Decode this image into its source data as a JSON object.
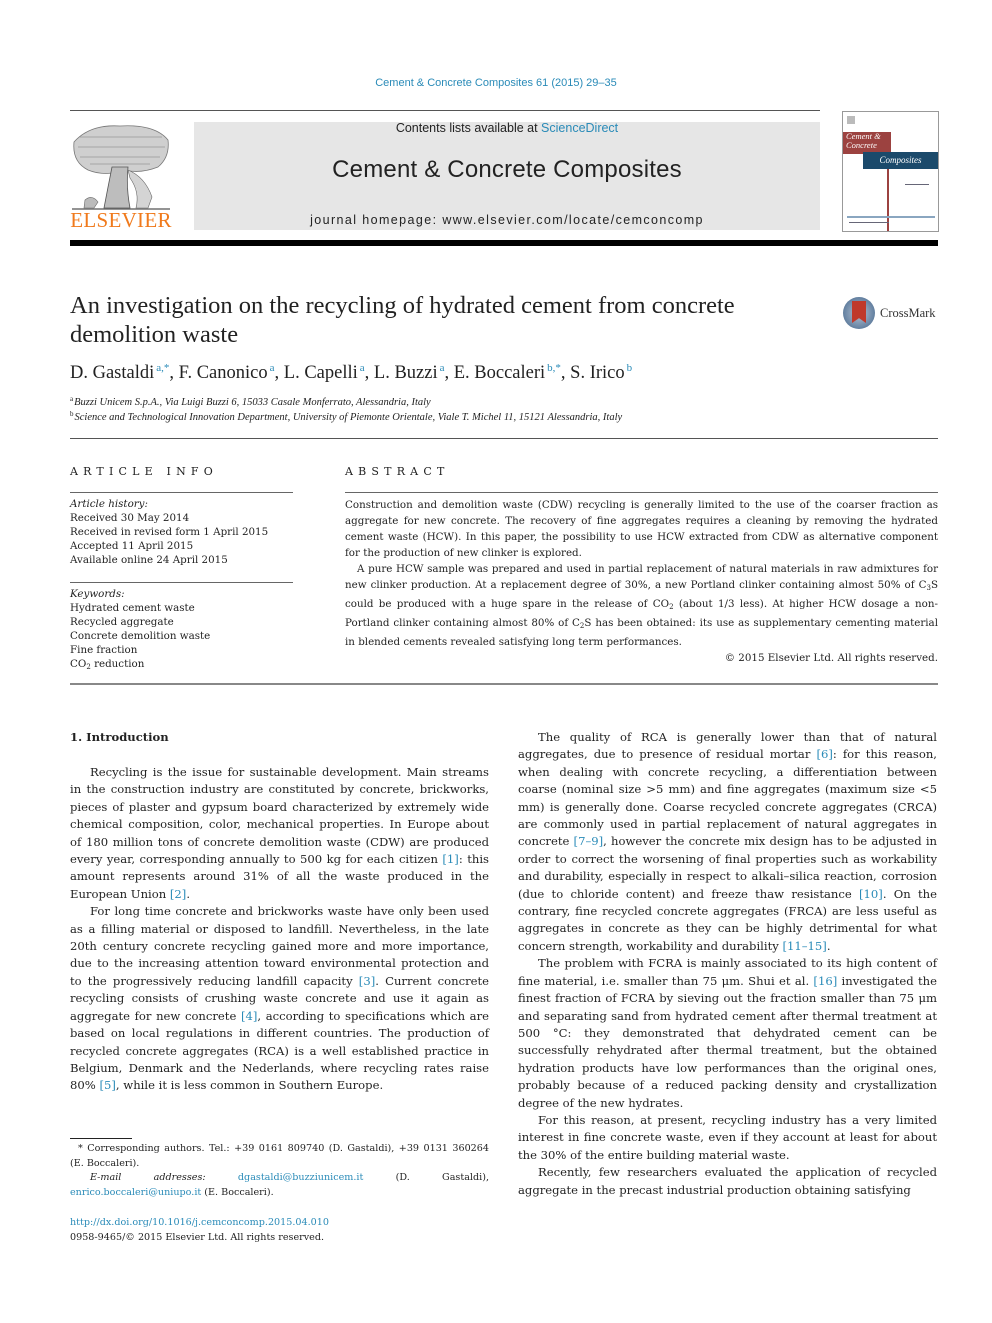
{
  "header": {
    "journal_ref": "Cement & Concrete Composites 61 (2015) 29–35",
    "contents_prefix": "Contents lists available at ",
    "contents_link": "ScienceDirect",
    "journal_name": "Cement & Concrete Composites",
    "homepage_prefix": "journal homepage: ",
    "homepage_url": "www.elsevier.com/locate/cemconcomp",
    "publisher_logo_text": "ELSEVIER",
    "cover": {
      "line1": "Cement &",
      "line2": "Concrete",
      "line3": "Composites"
    }
  },
  "article": {
    "title": "An investigation on the recycling of hydrated cement from concrete demolition waste",
    "crossmark_label": "CrossMark",
    "authors": [
      {
        "name": "D. Gastaldi",
        "sup": "a,*"
      },
      {
        "name": "F. Canonico",
        "sup": "a"
      },
      {
        "name": "L. Capelli",
        "sup": "a"
      },
      {
        "name": "L. Buzzi",
        "sup": "a"
      },
      {
        "name": "E. Boccaleri",
        "sup": "b,*"
      },
      {
        "name": "S. Irico",
        "sup": "b"
      }
    ],
    "affiliations": [
      {
        "key": "a",
        "text": "Buzzi Unicem S.p.A., Via Luigi Buzzi 6, 15033 Casale Monferrato, Alessandria, Italy"
      },
      {
        "key": "b",
        "text": "Science and Technological Innovation Department, University of Piemonte Orientale, Viale T. Michel 11, 15121 Alessandria, Italy"
      }
    ]
  },
  "article_info": {
    "heading": "ARTICLE INFO",
    "history_label": "Article history:",
    "history": [
      "Received 30 May 2014",
      "Received in revised form 1 April 2015",
      "Accepted 11 April 2015",
      "Available online 24 April 2015"
    ],
    "keywords_label": "Keywords:",
    "keywords": [
      "Hydrated cement waste",
      "Recycled aggregate",
      "Concrete demolition waste",
      "Fine fraction"
    ],
    "keyword_co2_prefix": "CO",
    "keyword_co2_sub": "2",
    "keyword_co2_suffix": " reduction"
  },
  "abstract": {
    "heading": "ABSTRACT",
    "p1": "Construction and demolition waste (CDW) recycling is generally limited to the use of the coarser fraction as aggregate for new concrete. The recovery of fine aggregates requires a cleaning by removing the hydrated cement waste (HCW). In this paper, the possibility to use HCW extracted from CDW as alternative component for the production of new clinker is explored.",
    "p2_a": "A pure HCW sample was prepared and used in partial replacement of natural materials in raw admixtures for new clinker production. At a replacement degree of 30%, a new Portland clinker containing almost 50% of C",
    "p2_sub1": "3",
    "p2_b": "S could be produced with a huge spare in the release of CO",
    "p2_sub2": "2",
    "p2_c": " (about 1/3 less). At higher HCW dosage a non-Portland clinker containing almost 80% of C",
    "p2_sub3": "2",
    "p2_d": "S has been obtained: its use as supplementary cementing material in blended cements revealed satisfying long term performances.",
    "copyright": "© 2015 Elsevier Ltd. All rights reserved."
  },
  "body": {
    "intro_heading": "1. Introduction",
    "left": {
      "p1_a": "Recycling is the issue for sustainable development. Main streams in the construction industry are constituted by concrete, brickworks, pieces of plaster and gypsum board characterized by extremely wide chemical composition, color, mechanical properties. In Europe about of 180 million tons of concrete demolition waste (CDW) are produced every year, corresponding annually to 500 kg for each citizen ",
      "p1_ref1": "[1]",
      "p1_b": ": this amount represents around 31% of all the waste produced in the European Union ",
      "p1_ref2": "[2]",
      "p1_c": ".",
      "p2_a": "For long time concrete and brickworks waste have only been used as a filling material or disposed to landfill. Nevertheless, in the late 20th century concrete recycling gained more and more importance, due to the increasing attention toward environmental protection and to the progressively reducing landfill capacity ",
      "p2_ref3": "[3]",
      "p2_b": ". Current concrete recycling consists of crushing waste concrete and use it again as aggregate for new concrete ",
      "p2_ref4": "[4]",
      "p2_c": ", according to specifications which are based on local regulations in different countries. The production of recycled concrete aggregates (RCA) is a well established practice in Belgium, Denmark and the Nederlands, where recycling rates raise 80% ",
      "p2_ref5": "[5]",
      "p2_d": ", while it is less common in Southern Europe."
    },
    "right": {
      "p1_a": "The quality of RCA is generally lower than that of natural aggregates, due to presence of residual mortar ",
      "p1_ref6": "[6]",
      "p1_b": ": for this reason, when dealing with concrete recycling, a differentiation between coarse (nominal size >5 mm) and fine aggregates (maximum size <5 mm) is generally done. Coarse recycled concrete aggregates (CRCA) are commonly used in partial replacement of natural aggregates in concrete ",
      "p1_ref7": "[7–9]",
      "p1_c": ", however the concrete mix design has to be adjusted in order to correct the worsening of final properties such as workability and durability, especially in respect to alkali–silica reaction, corrosion (due to chloride content) and freeze thaw resistance ",
      "p1_ref10": "[10]",
      "p1_d": ". On the contrary, fine recycled concrete aggregates (FRCA) are less useful as aggregates in concrete as they can be highly detrimental for what concern strength, workability and durability ",
      "p1_ref11": "[11–15]",
      "p1_e": ".",
      "p2_a": "The problem with FCRA is mainly associated to its high content of fine material, i.e. smaller than 75 μm. Shui et al. ",
      "p2_ref16": "[16]",
      "p2_b": " investigated the finest fraction of FCRA by sieving out the fraction smaller than 75 μm and separating sand from hydrated cement after thermal treatment at 500 °C: they demonstrated that dehydrated cement can be successfully rehydrated after thermal treatment, but the obtained hydration products have low performances than the original ones, probably because of a reduced packing density and crystallization degree of the new hydrates.",
      "p3": "For this reason, at present, recycling industry has a very limited interest in fine concrete waste, even if they account at least for about the 30% of the entire building material waste.",
      "p4": "Recently, few researchers evaluated the application of recycled aggregate in the precast industrial production obtaining satisfying"
    }
  },
  "footnotes": {
    "corresponding": "* Corresponding authors. Tel.: +39 0161 809740 (D. Gastaldi), +39 0131 360264 (E. Boccaleri).",
    "email_label": "E-mail addresses:",
    "email1": "dgastaldi@buzziunicem.it",
    "email1_owner": " (D. Gastaldi), ",
    "email2": "enrico.boccaleri@uniupo.it",
    "email2_owner": " (E. Boccaleri).",
    "doi": "http://dx.doi.org/10.1016/j.cemconcomp.2015.04.010",
    "issn_copyright": "0958-9465/© 2015 Elsevier Ltd. All rights reserved."
  }
}
